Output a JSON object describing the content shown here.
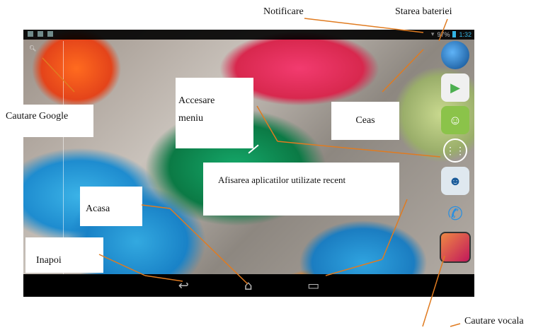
{
  "annotations": {
    "notificare": "Notificare",
    "starea_bateriei": "Starea bateriei",
    "cautare_google": "Cautare Google",
    "accesare_meniu": "Accesare meniu",
    "ceas": "Ceas",
    "afisarea_aplicatiilor": "Afisarea aplicatilor utilizate recent",
    "acasa": "Acasa",
    "inapoi": "Inapoi",
    "cautare_vocala": "Cautare vocala"
  },
  "statusbar": {
    "battery": "97%",
    "time": "1:32"
  },
  "dock": [
    "browser-icon",
    "play-store-icon",
    "talk-icon",
    "apps-icon",
    "contacts-icon",
    "phone-icon",
    "gallery-icon"
  ],
  "colors": {
    "line": "#e07b20",
    "accent": "#33b5e5"
  }
}
